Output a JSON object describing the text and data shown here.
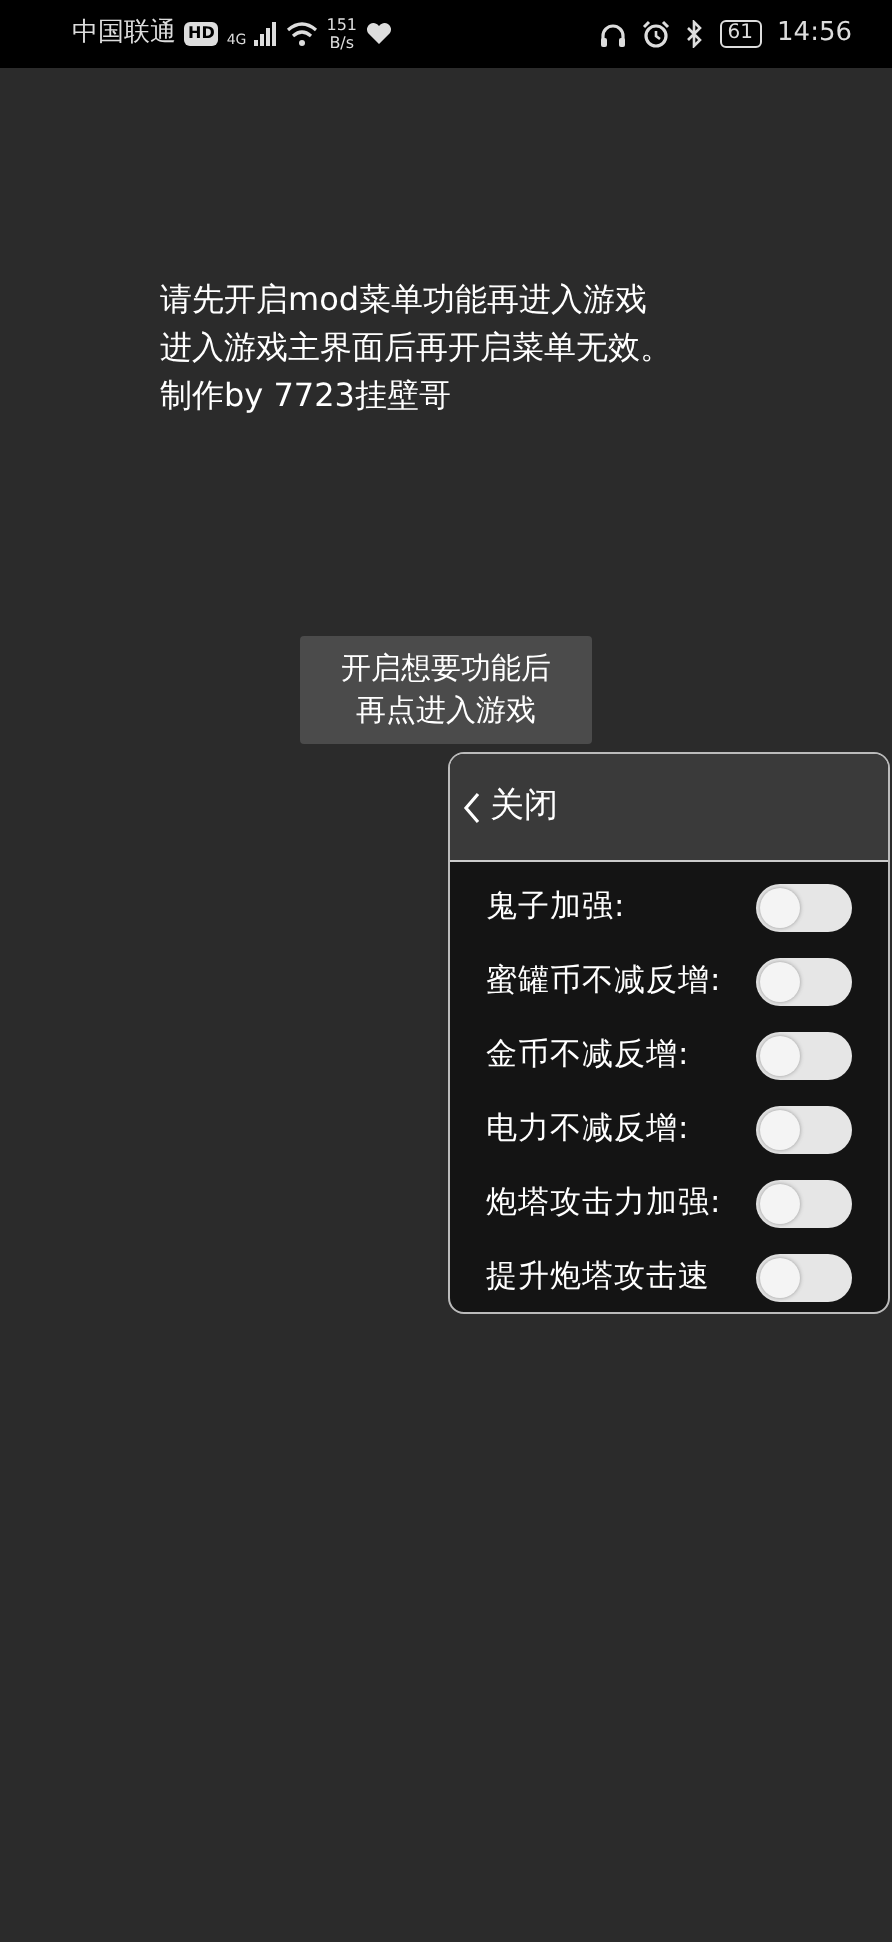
{
  "status_bar": {
    "carrier": "中国联通",
    "hd_badge": "HD",
    "network": "4G",
    "speed_value": "151",
    "speed_unit": "B/s",
    "battery": "61",
    "time": "14:56"
  },
  "notice": [
    "请先开启mod菜单功能再进入游戏",
    "进入游戏主界面后再开启菜单无效。",
    "制作by 7723挂壁哥"
  ],
  "start_button": {
    "lines": [
      "开启想要功能后",
      "再点进入游戏"
    ]
  },
  "menu": {
    "close_label": "关闭",
    "options": [
      {
        "label": "鬼子加强:",
        "on": false
      },
      {
        "label": "蜜罐币不减反增:",
        "on": false
      },
      {
        "label": "金币不减反增:",
        "on": false
      },
      {
        "label": "电力不减反增:",
        "on": false
      },
      {
        "label": "炮塔攻击力加强:",
        "on": false
      },
      {
        "label": "提升炮塔攻击速",
        "on": false
      }
    ]
  }
}
